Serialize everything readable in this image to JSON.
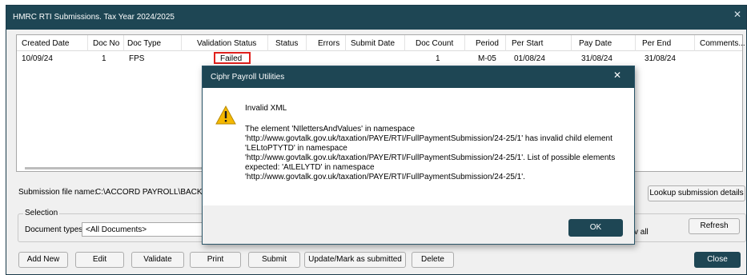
{
  "window": {
    "title": "HMRC RTI Submissions. Tax Year 2024/2025",
    "close_glyph": "✕"
  },
  "grid": {
    "columns": [
      "Created Date",
      "Doc No",
      "Doc Type",
      "Validation Status",
      "Status",
      "Errors",
      "Submit Date",
      "Doc Count",
      "Period",
      "Per Start",
      "Pay Date",
      "Per End",
      "Comments..."
    ],
    "rows": [
      {
        "created_date": "10/09/24",
        "doc_no": "1",
        "doc_type": "FPS",
        "validation_status": "Failed",
        "status": "",
        "errors": "",
        "submit_date": "",
        "doc_count": "1",
        "period": "M-05",
        "per_start": "01/08/24",
        "pay_date": "31/08/24",
        "per_end": "31/08/24",
        "comments": ""
      }
    ]
  },
  "submission_file": {
    "label": "Submission file name:",
    "value": "C:\\ACCORD PAYROLL\\BACKUP"
  },
  "buttons": {
    "lookup": "Lookup submission details",
    "refresh": "Refresh",
    "add_new": "Add New",
    "edit": "Edit",
    "validate": "Validate",
    "print": "Print",
    "submit": "Submit",
    "update_mark": "Update/Mark as submitted",
    "delete": "Delete",
    "close": "Close"
  },
  "selection": {
    "legend": "Selection",
    "doc_types_label": "Document types:",
    "doc_types_value": "<All Documents>",
    "show_all_partial": "v all"
  },
  "dialog": {
    "title": "Ciphr Payroll Utilities",
    "close_glyph": "✕",
    "heading": "Invalid XML",
    "message_lines": [
      "The element 'NIlettersAndValues' in namespace",
      "'http://www.govtalk.gov.uk/taxation/PAYE/RTI/FullPaymentSubmission/24-25/1' has invalid child element",
      "'LELtoPTYTD' in namespace",
      "'http://www.govtalk.gov.uk/taxation/PAYE/RTI/FullPaymentSubmission/24-25/1'. List of possible elements",
      "expected: 'AtLELYTD' in namespace",
      "'http://www.govtalk.gov.uk/taxation/PAYE/RTI/FullPaymentSubmission/24-25/1'."
    ],
    "ok_label": "OK",
    "icon": "warning-icon"
  },
  "colors": {
    "titlebar": "#1e4654",
    "highlight_border": "#e0201c",
    "warning_fill": "#f5b800"
  }
}
